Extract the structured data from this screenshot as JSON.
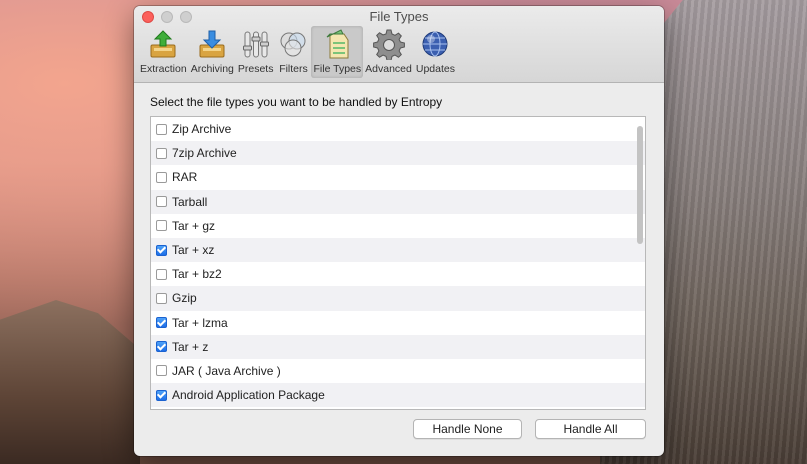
{
  "window": {
    "title": "File Types"
  },
  "toolbar": {
    "items": [
      {
        "label": "Extraction",
        "icon": "extraction-icon",
        "active": false
      },
      {
        "label": "Archiving",
        "icon": "archiving-icon",
        "active": false
      },
      {
        "label": "Presets",
        "icon": "presets-icon",
        "active": false
      },
      {
        "label": "Filters",
        "icon": "filters-icon",
        "active": false
      },
      {
        "label": "File Types",
        "icon": "file-types-icon",
        "active": true
      },
      {
        "label": "Advanced",
        "icon": "gear-icon",
        "active": false
      },
      {
        "label": "Updates",
        "icon": "globe-icon",
        "active": false
      }
    ]
  },
  "main": {
    "instruction": "Select the file types you want to be handled by Entropy",
    "file_types": [
      {
        "label": "Zip Archive",
        "checked": false
      },
      {
        "label": "7zip Archive",
        "checked": false
      },
      {
        "label": "RAR",
        "checked": false
      },
      {
        "label": "Tarball",
        "checked": false
      },
      {
        "label": "Tar + gz",
        "checked": false
      },
      {
        "label": "Tar + xz",
        "checked": true
      },
      {
        "label": "Tar + bz2",
        "checked": false
      },
      {
        "label": "Gzip",
        "checked": false
      },
      {
        "label": "Tar + lzma",
        "checked": true
      },
      {
        "label": "Tar + z",
        "checked": true
      },
      {
        "label": "JAR ( Java Archive )",
        "checked": false
      },
      {
        "label": "Android Application Package",
        "checked": true
      }
    ]
  },
  "buttons": {
    "handle_none": "Handle None",
    "handle_all": "Handle All"
  },
  "colors": {
    "accent": "#1d6ee8",
    "close": "#fc605c"
  }
}
